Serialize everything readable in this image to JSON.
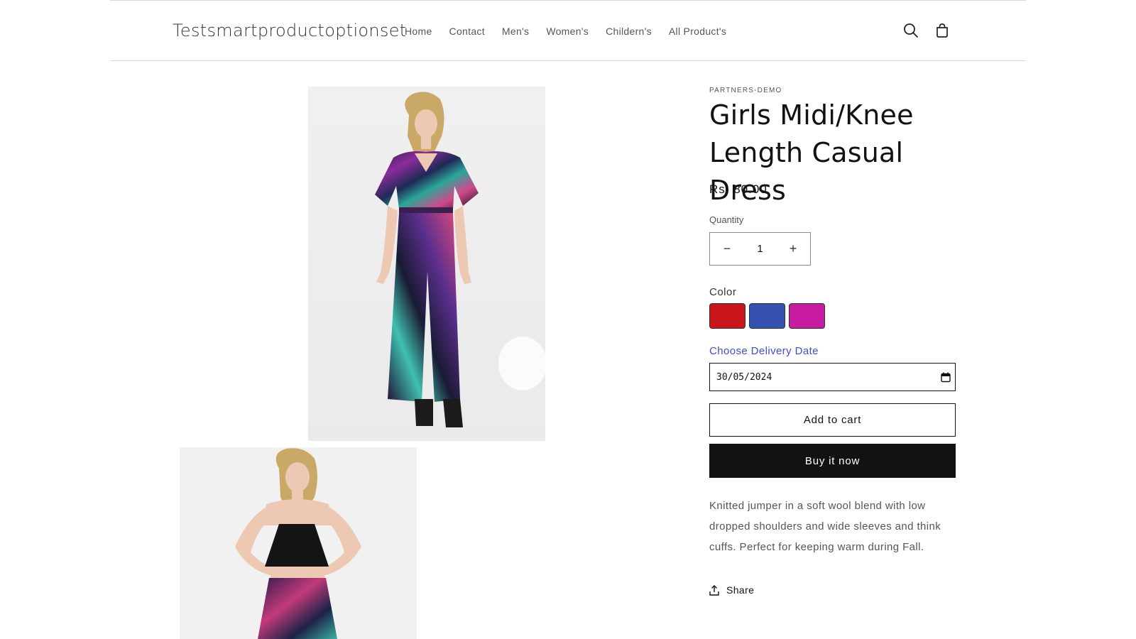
{
  "header": {
    "logo": "Testsmartproductoptionset",
    "nav": [
      "Home",
      "Contact",
      "Men's",
      "Women's",
      "Childern's",
      "All Product's"
    ],
    "icons": [
      "search-icon",
      "cart-icon"
    ]
  },
  "gallery": {
    "images": [
      "product-photo-galaxy-jumpsuit",
      "product-photo-crop-top-and-pants"
    ]
  },
  "product": {
    "vendor": "PARTNERS-DEMO",
    "title": "Girls Midi/Knee Length Casual Dress",
    "price": "Rs. 80.00",
    "quantity_label": "Quantity",
    "quantity_value": "1",
    "decrease_symbol": "−",
    "increase_symbol": "+",
    "color_label": "Color",
    "colors": [
      {
        "name": "red",
        "hex": "#c8161a"
      },
      {
        "name": "blue",
        "hex": "#3552b0"
      },
      {
        "name": "magenta",
        "hex": "#c71ba0"
      }
    ],
    "delivery_label": "Choose Delivery Date",
    "delivery_date": "30/05/2024",
    "add_to_cart": "Add to cart",
    "buy_now": "Buy it now",
    "description": "Knitted jumper in a soft wool blend with low dropped shoulders and wide sleeves and think cuffs. Perfect for keeping warm during Fall.",
    "share": "Share"
  },
  "colors": {
    "accent_link": "#3b4fd1",
    "button_dark": "#121212"
  }
}
